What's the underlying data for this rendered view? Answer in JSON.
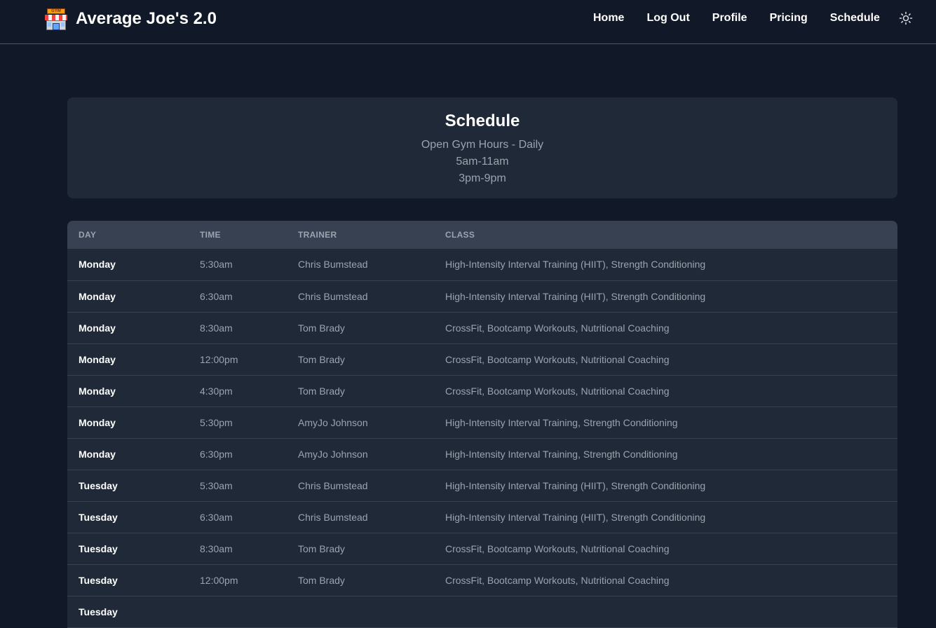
{
  "header": {
    "brand": "Average Joe's 2.0",
    "logo_sign": "GYM",
    "nav": [
      "Home",
      "Log Out",
      "Profile",
      "Pricing",
      "Schedule"
    ],
    "theme_icon": "sun-icon"
  },
  "hero": {
    "title": "Schedule",
    "lines": [
      "Open Gym Hours - Daily",
      "5am-11am",
      "3pm-9pm"
    ]
  },
  "table": {
    "columns": [
      "Day",
      "Time",
      "Trainer",
      "Class"
    ],
    "rows": [
      [
        "Monday",
        "5:30am",
        "Chris Bumstead",
        "High-Intensity Interval Training (HIIT), Strength Conditioning"
      ],
      [
        "Monday",
        "6:30am",
        "Chris Bumstead",
        "High-Intensity Interval Training (HIIT), Strength Conditioning"
      ],
      [
        "Monday",
        "8:30am",
        "Tom Brady",
        "CrossFit, Bootcamp Workouts, Nutritional Coaching"
      ],
      [
        "Monday",
        "12:00pm",
        "Tom Brady",
        "CrossFit, Bootcamp Workouts, Nutritional Coaching"
      ],
      [
        "Monday",
        "4:30pm",
        "Tom Brady",
        "CrossFit, Bootcamp Workouts, Nutritional Coaching"
      ],
      [
        "Monday",
        "5:30pm",
        "AmyJo Johnson",
        "High-Intensity Interval Training, Strength Conditioning"
      ],
      [
        "Monday",
        "6:30pm",
        "AmyJo Johnson",
        "High-Intensity Interval Training, Strength Conditioning"
      ],
      [
        "Tuesday",
        "5:30am",
        "Chris Bumstead",
        "High-Intensity Interval Training (HIIT), Strength Conditioning"
      ],
      [
        "Tuesday",
        "6:30am",
        "Chris Bumstead",
        "High-Intensity Interval Training (HIIT), Strength Conditioning"
      ],
      [
        "Tuesday",
        "8:30am",
        "Tom Brady",
        "CrossFit, Bootcamp Workouts, Nutritional Coaching"
      ],
      [
        "Tuesday",
        "12:00pm",
        "Tom Brady",
        "CrossFit, Bootcamp Workouts, Nutritional Coaching"
      ],
      [
        "Tuesday",
        "",
        "",
        ""
      ]
    ]
  },
  "colors": {
    "page_bg": "#111827",
    "card_bg": "#1f2937",
    "table_header_bg": "#374151",
    "text_muted": "#9ca3af",
    "text_strong": "#ffffff"
  }
}
